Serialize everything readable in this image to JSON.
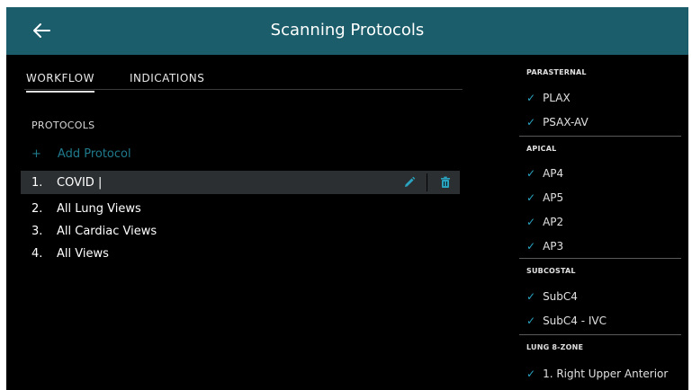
{
  "header": {
    "title": "Scanning Protocols",
    "back_icon": "back-arrow-icon"
  },
  "tabs": [
    {
      "label": "WORKFLOW",
      "active": true
    },
    {
      "label": "INDICATIONS",
      "active": false
    }
  ],
  "protocols": {
    "section_label": "PROTOCOLS",
    "add_label": "Add Protocol",
    "add_icon": "+",
    "items": [
      {
        "num": "1.",
        "name": "COVID |",
        "selected": true
      },
      {
        "num": "2.",
        "name": "All Lung Views"
      },
      {
        "num": "3.",
        "name": "All Cardiac Views"
      },
      {
        "num": "4.",
        "name": "All Views"
      }
    ]
  },
  "views": {
    "check_glyph": "✓",
    "categories": [
      {
        "label": "PARASTERNAL",
        "items": [
          "PLAX",
          "PSAX-AV"
        ]
      },
      {
        "label": "APICAL",
        "items": [
          "AP4",
          "AP5",
          "AP2",
          "AP3"
        ]
      },
      {
        "label": "SUBCOSTAL",
        "items": [
          "SubC4",
          "SubC4 - IVC"
        ]
      },
      {
        "label": "LUNG 8-ZONE",
        "items": [
          "1. Right Upper Anterior"
        ]
      }
    ]
  },
  "colors": {
    "header": "#1b5d6a",
    "accent": "#2aa3c0",
    "add": "#1f7a8c",
    "background": "#000000"
  }
}
